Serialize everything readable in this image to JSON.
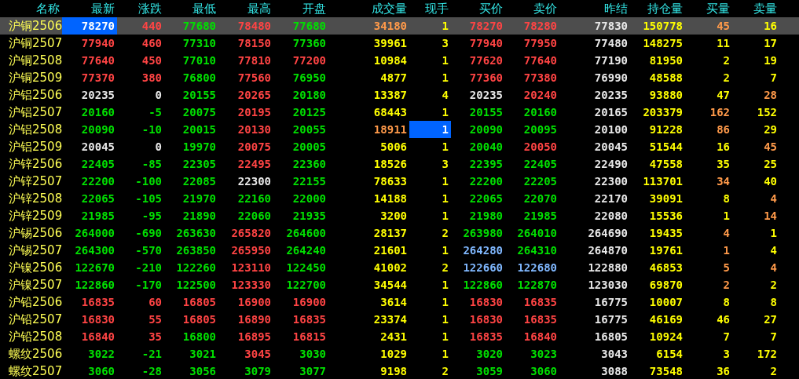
{
  "columns": [
    "名称",
    "最新",
    "涨跌",
    "最低",
    "最高",
    "开盘",
    "成交量",
    "现手",
    "买价",
    "卖价",
    "昨结",
    "持仓量",
    "买量",
    "卖量"
  ],
  "rows": [
    {
      "selected": true,
      "name": "沪铜2506",
      "cells": [
        {
          "text": "78270",
          "focused": true
        },
        {
          "text": "440",
          "color": "#ff4444"
        },
        {
          "text": "77680",
          "color": "#00e000"
        },
        {
          "text": "78480",
          "color": "#ff4444"
        },
        {
          "text": "77680",
          "color": "#00e000"
        },
        {
          "text": "34180",
          "color": "#ff9a4a"
        },
        {
          "text": "1",
          "color": "#ffff00"
        },
        {
          "text": "78270",
          "color": "#ff4444"
        },
        {
          "text": "78280",
          "color": "#ff4444"
        },
        {
          "text": "77830",
          "color": "#e8e8e8"
        },
        {
          "text": "150778",
          "color": "#ffff00"
        },
        {
          "text": "45",
          "color": "#ff9a4a"
        },
        {
          "text": "16",
          "color": "#ffff00"
        }
      ]
    },
    {
      "selected": false,
      "name": "沪铜2507",
      "cells": [
        {
          "text": "77940",
          "color": "#ff4444"
        },
        {
          "text": "460",
          "color": "#ff4444"
        },
        {
          "text": "77310",
          "color": "#00e000"
        },
        {
          "text": "78150",
          "color": "#ff4444"
        },
        {
          "text": "77360",
          "color": "#00e000"
        },
        {
          "text": "39961",
          "color": "#ffff00"
        },
        {
          "text": "3",
          "color": "#ffff00"
        },
        {
          "text": "77940",
          "color": "#ff4444"
        },
        {
          "text": "77950",
          "color": "#ff4444"
        },
        {
          "text": "77480",
          "color": "#e8e8e8"
        },
        {
          "text": "148275",
          "color": "#ffff00"
        },
        {
          "text": "11",
          "color": "#ffff00"
        },
        {
          "text": "17",
          "color": "#ffff00"
        }
      ]
    },
    {
      "selected": false,
      "name": "沪铜2508",
      "cells": [
        {
          "text": "77640",
          "color": "#ff4444"
        },
        {
          "text": "450",
          "color": "#ff4444"
        },
        {
          "text": "77010",
          "color": "#00e000"
        },
        {
          "text": "77810",
          "color": "#ff4444"
        },
        {
          "text": "77200",
          "color": "#ff4444"
        },
        {
          "text": "10984",
          "color": "#ffff00"
        },
        {
          "text": "1",
          "color": "#ffff00"
        },
        {
          "text": "77620",
          "color": "#ff4444"
        },
        {
          "text": "77640",
          "color": "#ff4444"
        },
        {
          "text": "77190",
          "color": "#e8e8e8"
        },
        {
          "text": "81950",
          "color": "#ffff00"
        },
        {
          "text": "2",
          "color": "#ffff00"
        },
        {
          "text": "19",
          "color": "#ffff00"
        }
      ]
    },
    {
      "selected": false,
      "name": "沪铜2509",
      "cells": [
        {
          "text": "77370",
          "color": "#ff4444"
        },
        {
          "text": "380",
          "color": "#ff4444"
        },
        {
          "text": "76800",
          "color": "#00e000"
        },
        {
          "text": "77560",
          "color": "#ff4444"
        },
        {
          "text": "76950",
          "color": "#00e000"
        },
        {
          "text": "4877",
          "color": "#ffff00"
        },
        {
          "text": "1",
          "color": "#ffff00"
        },
        {
          "text": "77360",
          "color": "#ff4444"
        },
        {
          "text": "77380",
          "color": "#ff4444"
        },
        {
          "text": "76990",
          "color": "#e8e8e8"
        },
        {
          "text": "48588",
          "color": "#ffff00"
        },
        {
          "text": "2",
          "color": "#ffff00"
        },
        {
          "text": "7",
          "color": "#ffff00"
        }
      ]
    },
    {
      "selected": false,
      "name": "沪铝2506",
      "cells": [
        {
          "text": "20235",
          "color": "#e8e8e8"
        },
        {
          "text": "0",
          "color": "#e8e8e8"
        },
        {
          "text": "20155",
          "color": "#00e000"
        },
        {
          "text": "20265",
          "color": "#ff4444"
        },
        {
          "text": "20180",
          "color": "#00e000"
        },
        {
          "text": "13387",
          "color": "#ffff00"
        },
        {
          "text": "4",
          "color": "#ffff00"
        },
        {
          "text": "20235",
          "color": "#e8e8e8"
        },
        {
          "text": "20240",
          "color": "#ff4444"
        },
        {
          "text": "20235",
          "color": "#e8e8e8"
        },
        {
          "text": "93880",
          "color": "#ffff00"
        },
        {
          "text": "47",
          "color": "#ffff00"
        },
        {
          "text": "28",
          "color": "#ff9a4a"
        }
      ]
    },
    {
      "selected": false,
      "name": "沪铝2507",
      "cells": [
        {
          "text": "20160",
          "color": "#00e000"
        },
        {
          "text": "-5",
          "color": "#00e000"
        },
        {
          "text": "20075",
          "color": "#00e000"
        },
        {
          "text": "20195",
          "color": "#ff4444"
        },
        {
          "text": "20125",
          "color": "#00e000"
        },
        {
          "text": "68443",
          "color": "#ffff00"
        },
        {
          "text": "1",
          "color": "#ffff00"
        },
        {
          "text": "20155",
          "color": "#00e000"
        },
        {
          "text": "20160",
          "color": "#00e000"
        },
        {
          "text": "20165",
          "color": "#e8e8e8"
        },
        {
          "text": "203379",
          "color": "#ffff00"
        },
        {
          "text": "162",
          "color": "#ff9a4a"
        },
        {
          "text": "152",
          "color": "#ffff00"
        }
      ]
    },
    {
      "selected": false,
      "name": "沪铝2508",
      "cells": [
        {
          "text": "20090",
          "color": "#00e000"
        },
        {
          "text": "-10",
          "color": "#00e000"
        },
        {
          "text": "20015",
          "color": "#00e000"
        },
        {
          "text": "20130",
          "color": "#ff4444"
        },
        {
          "text": "20055",
          "color": "#00e000"
        },
        {
          "text": "18911",
          "color": "#ff9a4a"
        },
        {
          "text": "1",
          "focused": true
        },
        {
          "text": "20090",
          "color": "#00e000"
        },
        {
          "text": "20095",
          "color": "#00e000"
        },
        {
          "text": "20100",
          "color": "#e8e8e8"
        },
        {
          "text": "91228",
          "color": "#ffff00"
        },
        {
          "text": "86",
          "color": "#ff9a4a"
        },
        {
          "text": "29",
          "color": "#ffff00"
        }
      ]
    },
    {
      "selected": false,
      "name": "沪铝2509",
      "cells": [
        {
          "text": "20045",
          "color": "#e8e8e8"
        },
        {
          "text": "0",
          "color": "#e8e8e8"
        },
        {
          "text": "19970",
          "color": "#00e000"
        },
        {
          "text": "20075",
          "color": "#ff4444"
        },
        {
          "text": "20005",
          "color": "#00e000"
        },
        {
          "text": "5006",
          "color": "#ffff00"
        },
        {
          "text": "1",
          "color": "#ffff00"
        },
        {
          "text": "20040",
          "color": "#00e000"
        },
        {
          "text": "20050",
          "color": "#ff4444"
        },
        {
          "text": "20045",
          "color": "#e8e8e8"
        },
        {
          "text": "51544",
          "color": "#ffff00"
        },
        {
          "text": "16",
          "color": "#ffff00"
        },
        {
          "text": "45",
          "color": "#ff9a4a"
        }
      ]
    },
    {
      "selected": false,
      "name": "沪锌2506",
      "cells": [
        {
          "text": "22405",
          "color": "#00e000"
        },
        {
          "text": "-85",
          "color": "#00e000"
        },
        {
          "text": "22305",
          "color": "#00e000"
        },
        {
          "text": "22495",
          "color": "#ff4444"
        },
        {
          "text": "22360",
          "color": "#00e000"
        },
        {
          "text": "18526",
          "color": "#ffff00"
        },
        {
          "text": "3",
          "color": "#ffff00"
        },
        {
          "text": "22395",
          "color": "#00e000"
        },
        {
          "text": "22405",
          "color": "#00e000"
        },
        {
          "text": "22490",
          "color": "#e8e8e8"
        },
        {
          "text": "47558",
          "color": "#ffff00"
        },
        {
          "text": "35",
          "color": "#ffff00"
        },
        {
          "text": "25",
          "color": "#ffff00"
        }
      ]
    },
    {
      "selected": false,
      "name": "沪锌2507",
      "cells": [
        {
          "text": "22200",
          "color": "#00e000"
        },
        {
          "text": "-100",
          "color": "#00e000"
        },
        {
          "text": "22085",
          "color": "#00e000"
        },
        {
          "text": "22300",
          "color": "#e8e8e8"
        },
        {
          "text": "22155",
          "color": "#00e000"
        },
        {
          "text": "78633",
          "color": "#ffff00"
        },
        {
          "text": "1",
          "color": "#ffff00"
        },
        {
          "text": "22200",
          "color": "#00e000"
        },
        {
          "text": "22205",
          "color": "#00e000"
        },
        {
          "text": "22300",
          "color": "#e8e8e8"
        },
        {
          "text": "113701",
          "color": "#ffff00"
        },
        {
          "text": "34",
          "color": "#ff9a4a"
        },
        {
          "text": "40",
          "color": "#ffff00"
        }
      ]
    },
    {
      "selected": false,
      "name": "沪锌2508",
      "cells": [
        {
          "text": "22065",
          "color": "#00e000"
        },
        {
          "text": "-105",
          "color": "#00e000"
        },
        {
          "text": "21970",
          "color": "#00e000"
        },
        {
          "text": "22160",
          "color": "#00e000"
        },
        {
          "text": "22000",
          "color": "#00e000"
        },
        {
          "text": "14188",
          "color": "#ffff00"
        },
        {
          "text": "1",
          "color": "#ffff00"
        },
        {
          "text": "22065",
          "color": "#00e000"
        },
        {
          "text": "22070",
          "color": "#00e000"
        },
        {
          "text": "22170",
          "color": "#e8e8e8"
        },
        {
          "text": "39091",
          "color": "#ffff00"
        },
        {
          "text": "8",
          "color": "#ffff00"
        },
        {
          "text": "4",
          "color": "#ff9a4a"
        }
      ]
    },
    {
      "selected": false,
      "name": "沪锌2509",
      "cells": [
        {
          "text": "21985",
          "color": "#00e000"
        },
        {
          "text": "-95",
          "color": "#00e000"
        },
        {
          "text": "21890",
          "color": "#00e000"
        },
        {
          "text": "22060",
          "color": "#00e000"
        },
        {
          "text": "21935",
          "color": "#00e000"
        },
        {
          "text": "3200",
          "color": "#ffff00"
        },
        {
          "text": "1",
          "color": "#ffff00"
        },
        {
          "text": "21980",
          "color": "#00e000"
        },
        {
          "text": "21985",
          "color": "#00e000"
        },
        {
          "text": "22080",
          "color": "#e8e8e8"
        },
        {
          "text": "15536",
          "color": "#ffff00"
        },
        {
          "text": "1",
          "color": "#ffff00"
        },
        {
          "text": "14",
          "color": "#ff9a4a"
        }
      ]
    },
    {
      "selected": false,
      "name": "沪锡2506",
      "cells": [
        {
          "text": "264000",
          "color": "#00e000"
        },
        {
          "text": "-690",
          "color": "#00e000"
        },
        {
          "text": "263630",
          "color": "#00e000"
        },
        {
          "text": "265820",
          "color": "#ff4444"
        },
        {
          "text": "264600",
          "color": "#00e000"
        },
        {
          "text": "28137",
          "color": "#ffff00"
        },
        {
          "text": "2",
          "color": "#ffff00"
        },
        {
          "text": "263980",
          "color": "#00e000"
        },
        {
          "text": "264010",
          "color": "#00e000"
        },
        {
          "text": "264690",
          "color": "#e8e8e8"
        },
        {
          "text": "19435",
          "color": "#ffff00"
        },
        {
          "text": "4",
          "color": "#ff9a4a"
        },
        {
          "text": "1",
          "color": "#ffff00"
        }
      ]
    },
    {
      "selected": false,
      "name": "沪锡2507",
      "cells": [
        {
          "text": "264300",
          "color": "#00e000"
        },
        {
          "text": "-570",
          "color": "#00e000"
        },
        {
          "text": "263850",
          "color": "#00e000"
        },
        {
          "text": "265950",
          "color": "#ff4444"
        },
        {
          "text": "264240",
          "color": "#00e000"
        },
        {
          "text": "21601",
          "color": "#ffff00"
        },
        {
          "text": "1",
          "color": "#ffff00"
        },
        {
          "text": "264280",
          "color": "#80b8ff"
        },
        {
          "text": "264310",
          "color": "#00e000"
        },
        {
          "text": "264870",
          "color": "#e8e8e8"
        },
        {
          "text": "19761",
          "color": "#ffff00"
        },
        {
          "text": "1",
          "color": "#ff9a4a"
        },
        {
          "text": "4",
          "color": "#ffff00"
        }
      ]
    },
    {
      "selected": false,
      "name": "沪镍2506",
      "cells": [
        {
          "text": "122670",
          "color": "#00e000"
        },
        {
          "text": "-210",
          "color": "#00e000"
        },
        {
          "text": "122260",
          "color": "#00e000"
        },
        {
          "text": "123110",
          "color": "#ff4444"
        },
        {
          "text": "122450",
          "color": "#00e000"
        },
        {
          "text": "41002",
          "color": "#ffff00"
        },
        {
          "text": "2",
          "color": "#ffff00"
        },
        {
          "text": "122660",
          "color": "#80b8ff"
        },
        {
          "text": "122680",
          "color": "#80b8ff"
        },
        {
          "text": "122880",
          "color": "#e8e8e8"
        },
        {
          "text": "46853",
          "color": "#ffff00"
        },
        {
          "text": "5",
          "color": "#ff9a4a"
        },
        {
          "text": "4",
          "color": "#ff9a4a"
        }
      ]
    },
    {
      "selected": false,
      "name": "沪镍2507",
      "cells": [
        {
          "text": "122860",
          "color": "#00e000"
        },
        {
          "text": "-170",
          "color": "#00e000"
        },
        {
          "text": "122500",
          "color": "#00e000"
        },
        {
          "text": "123330",
          "color": "#ff4444"
        },
        {
          "text": "122700",
          "color": "#00e000"
        },
        {
          "text": "34544",
          "color": "#ffff00"
        },
        {
          "text": "1",
          "color": "#ffff00"
        },
        {
          "text": "122860",
          "color": "#00e000"
        },
        {
          "text": "122870",
          "color": "#00e000"
        },
        {
          "text": "123030",
          "color": "#e8e8e8"
        },
        {
          "text": "69870",
          "color": "#ffff00"
        },
        {
          "text": "2",
          "color": "#ff9a4a"
        },
        {
          "text": "2",
          "color": "#ffff00"
        }
      ]
    },
    {
      "selected": false,
      "name": "沪铅2506",
      "cells": [
        {
          "text": "16835",
          "color": "#ff4444"
        },
        {
          "text": "60",
          "color": "#ff4444"
        },
        {
          "text": "16805",
          "color": "#ff4444"
        },
        {
          "text": "16900",
          "color": "#ff4444"
        },
        {
          "text": "16900",
          "color": "#ff4444"
        },
        {
          "text": "3614",
          "color": "#ffff00"
        },
        {
          "text": "1",
          "color": "#ffff00"
        },
        {
          "text": "16830",
          "color": "#ff4444"
        },
        {
          "text": "16835",
          "color": "#ff4444"
        },
        {
          "text": "16775",
          "color": "#e8e8e8"
        },
        {
          "text": "10007",
          "color": "#ffff00"
        },
        {
          "text": "8",
          "color": "#ffff00"
        },
        {
          "text": "8",
          "color": "#ffff00"
        }
      ]
    },
    {
      "selected": false,
      "name": "沪铅2507",
      "cells": [
        {
          "text": "16830",
          "color": "#ff4444"
        },
        {
          "text": "55",
          "color": "#ff4444"
        },
        {
          "text": "16805",
          "color": "#ff4444"
        },
        {
          "text": "16890",
          "color": "#ff4444"
        },
        {
          "text": "16835",
          "color": "#ff4444"
        },
        {
          "text": "23374",
          "color": "#ffff00"
        },
        {
          "text": "1",
          "color": "#ffff00"
        },
        {
          "text": "16830",
          "color": "#ff4444"
        },
        {
          "text": "16835",
          "color": "#ff4444"
        },
        {
          "text": "16775",
          "color": "#e8e8e8"
        },
        {
          "text": "46169",
          "color": "#ffff00"
        },
        {
          "text": "46",
          "color": "#ffff00"
        },
        {
          "text": "27",
          "color": "#ffff00"
        }
      ]
    },
    {
      "selected": false,
      "name": "沪铅2508",
      "cells": [
        {
          "text": "16840",
          "color": "#ff4444"
        },
        {
          "text": "35",
          "color": "#ff4444"
        },
        {
          "text": "16800",
          "color": "#00e000"
        },
        {
          "text": "16895",
          "color": "#ff4444"
        },
        {
          "text": "16815",
          "color": "#ff4444"
        },
        {
          "text": "2431",
          "color": "#ffff00"
        },
        {
          "text": "1",
          "color": "#ffff00"
        },
        {
          "text": "16835",
          "color": "#ff4444"
        },
        {
          "text": "16840",
          "color": "#ff4444"
        },
        {
          "text": "16805",
          "color": "#e8e8e8"
        },
        {
          "text": "10924",
          "color": "#ffff00"
        },
        {
          "text": "7",
          "color": "#ffff00"
        },
        {
          "text": "7",
          "color": "#ffff00"
        }
      ]
    },
    {
      "selected": false,
      "name": "螺纹2506",
      "cells": [
        {
          "text": "3022",
          "color": "#00e000"
        },
        {
          "text": "-21",
          "color": "#00e000"
        },
        {
          "text": "3021",
          "color": "#00e000"
        },
        {
          "text": "3045",
          "color": "#ff4444"
        },
        {
          "text": "3030",
          "color": "#00e000"
        },
        {
          "text": "1029",
          "color": "#ffff00"
        },
        {
          "text": "1",
          "color": "#ffff00"
        },
        {
          "text": "3020",
          "color": "#00e000"
        },
        {
          "text": "3023",
          "color": "#00e000"
        },
        {
          "text": "3043",
          "color": "#e8e8e8"
        },
        {
          "text": "6154",
          "color": "#ffff00"
        },
        {
          "text": "3",
          "color": "#ffff00"
        },
        {
          "text": "172",
          "color": "#ffff00"
        }
      ]
    },
    {
      "selected": false,
      "name": "螺纹2507",
      "cells": [
        {
          "text": "3060",
          "color": "#00e000"
        },
        {
          "text": "-28",
          "color": "#00e000"
        },
        {
          "text": "3056",
          "color": "#00e000"
        },
        {
          "text": "3079",
          "color": "#00e000"
        },
        {
          "text": "3077",
          "color": "#00e000"
        },
        {
          "text": "9198",
          "color": "#ffff00"
        },
        {
          "text": "2",
          "color": "#ffff00"
        },
        {
          "text": "3059",
          "color": "#00e000"
        },
        {
          "text": "3060",
          "color": "#00e000"
        },
        {
          "text": "3088",
          "color": "#e8e8e8"
        },
        {
          "text": "73548",
          "color": "#ffff00"
        },
        {
          "text": "36",
          "color": "#ffff00"
        },
        {
          "text": "2",
          "color": "#ffff00"
        }
      ]
    }
  ]
}
